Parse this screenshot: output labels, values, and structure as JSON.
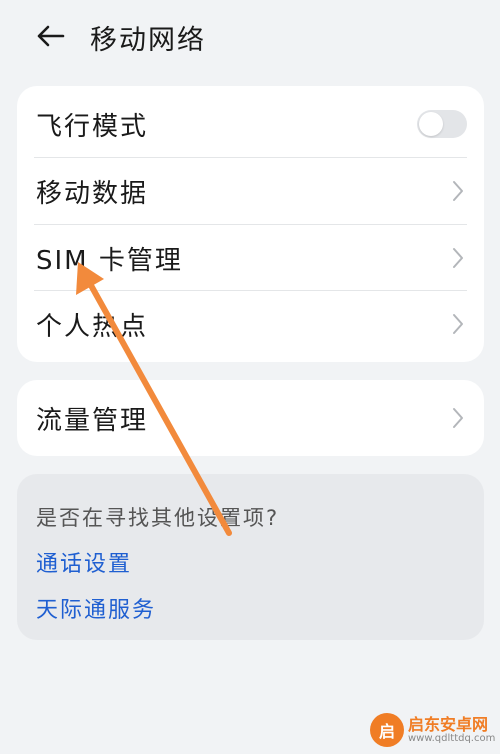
{
  "header": {
    "title": "移动网络"
  },
  "main_card": {
    "items": [
      {
        "label": "飞行模式",
        "control": "toggle",
        "toggle_on": false
      },
      {
        "label": "移动数据",
        "control": "chevron"
      },
      {
        "label": "SIM 卡管理",
        "control": "chevron"
      },
      {
        "label": "个人热点",
        "control": "chevron"
      }
    ]
  },
  "traffic_card": {
    "label": "流量管理"
  },
  "suggestions": {
    "title": "是否在寻找其他设置项?",
    "links": [
      "通话设置",
      "天际通服务"
    ]
  },
  "annotation": {
    "color": "#f28a3c"
  },
  "watermark": {
    "name": "启东安卓网",
    "url": "www.qdlttdq.com",
    "logo_char": "启"
  },
  "colors": {
    "link": "#1f5fd1",
    "background": "#f1f3f5",
    "card": "#ffffff"
  }
}
